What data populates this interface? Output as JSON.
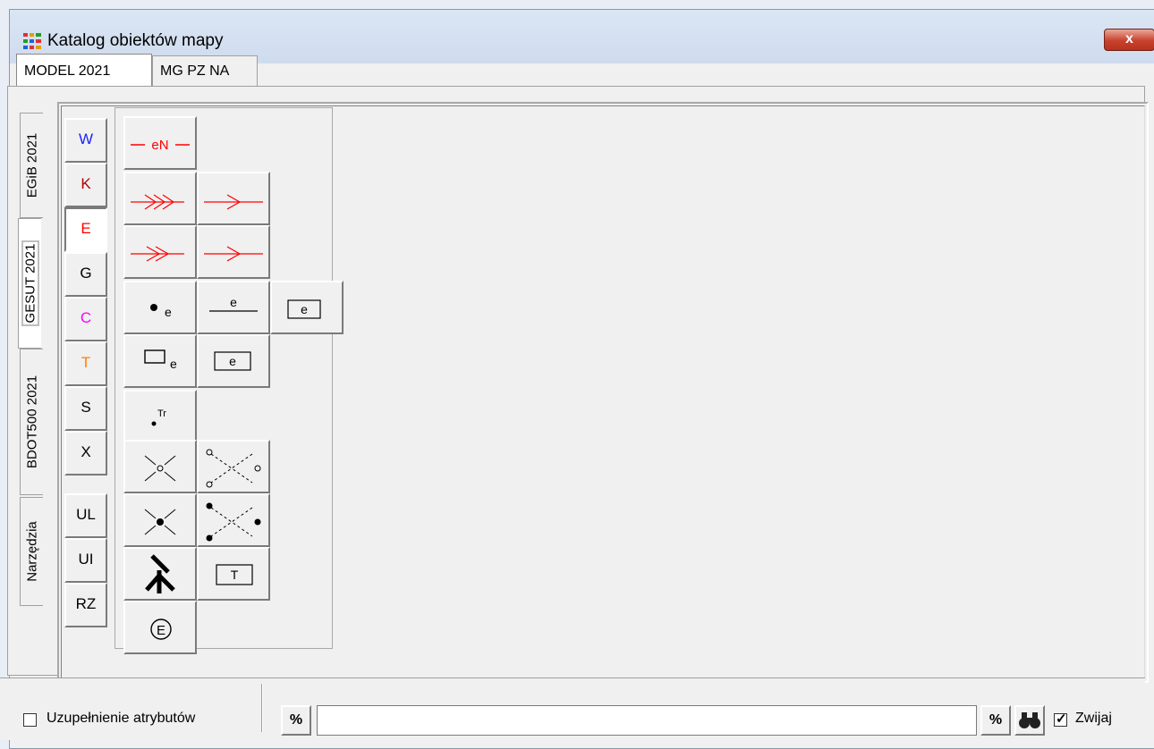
{
  "window": {
    "title": "Katalog obiektów mapy",
    "close_label": "x"
  },
  "tabs": [
    "MODEL 2021",
    "MG PZ NA"
  ],
  "side_tabs": [
    "EGiB 2021",
    "GESUT 2021",
    "BDOT500 2021",
    "Narzędzia"
  ],
  "categories": [
    {
      "label": "W",
      "color": "#2020ff"
    },
    {
      "label": "K",
      "color": "#b00000"
    },
    {
      "label": "E",
      "color": "#ff0000"
    },
    {
      "label": "G",
      "color": "#000000"
    },
    {
      "label": "C",
      "color": "#ff00ff"
    },
    {
      "label": "T",
      "color": "#ff8000"
    },
    {
      "label": "S",
      "color": "#000000"
    },
    {
      "label": "X",
      "color": "#000000"
    },
    {
      "label": "UL",
      "color": "#000000"
    },
    {
      "label": "UI",
      "color": "#000000"
    },
    {
      "label": "RZ",
      "color": "#000000"
    }
  ],
  "symbols": {
    "en_line": "eN",
    "point_label": "e",
    "line_label": "e",
    "box_label": "e",
    "rect_label": "e",
    "box2_label": "e",
    "tr_label": "Tr",
    "t_box_label": "T",
    "circle_e_label": "E"
  },
  "status": {
    "checkbox_label": "Uzupełnienie atrybutów",
    "checkbox_checked": false,
    "pct_left": "%",
    "search_value": "",
    "pct_right": "%",
    "collapse_label": "Zwijaj",
    "collapse_checked": true
  },
  "colors": {
    "red_symbol": "#ff0000",
    "accent_close": "#c8412d"
  }
}
